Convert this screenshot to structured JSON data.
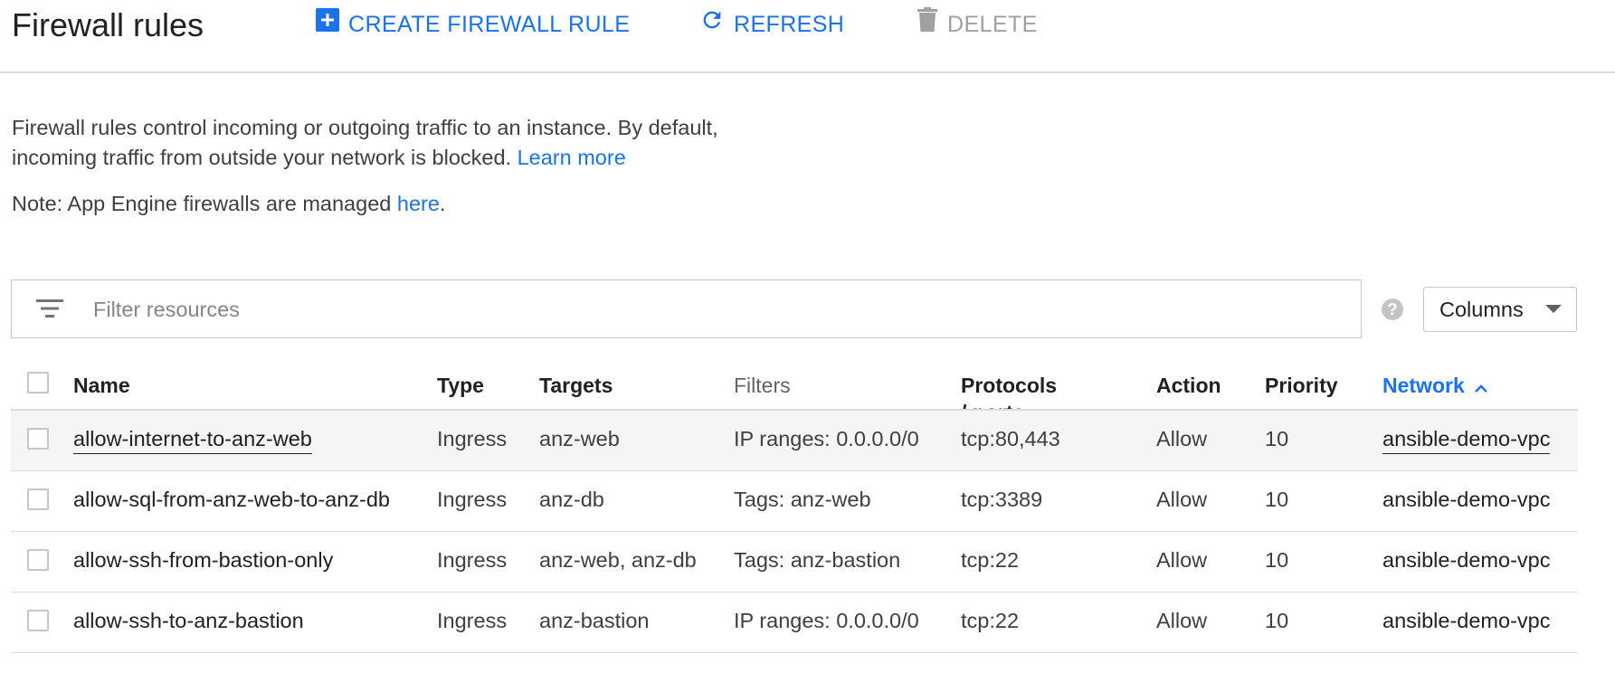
{
  "header": {
    "title": "Firewall rules",
    "create_label": "CREATE FIREWALL RULE",
    "refresh_label": "REFRESH",
    "delete_label": "DELETE"
  },
  "description": {
    "line1": "Firewall rules control incoming or outgoing traffic to an instance. By default,",
    "line2_prefix": "incoming traffic from outside your network is blocked.",
    "learn_more": "Learn more",
    "note_prefix": "Note: App Engine firewalls are managed",
    "note_link": "here",
    "note_suffix": "."
  },
  "filter": {
    "placeholder": "Filter resources",
    "help_glyph": "?",
    "columns_label": "Columns"
  },
  "table": {
    "headers": {
      "name": "Name",
      "type": "Type",
      "targets": "Targets",
      "filters": "Filters",
      "protocols": "Protocols / ports",
      "action": "Action",
      "priority": "Priority",
      "network": "Network"
    },
    "sort_column": "network",
    "sort_direction": "ascending",
    "rows": [
      {
        "name": "allow-internet-to-anz-web",
        "type": "Ingress",
        "targets": "anz-web",
        "filters": "IP ranges: 0.0.0.0/0",
        "protocols": "tcp:80,443",
        "action": "Allow",
        "priority": "10",
        "network": "ansible-demo-vpc"
      },
      {
        "name": "allow-sql-from-anz-web-to-anz-db",
        "type": "Ingress",
        "targets": "anz-db",
        "filters": "Tags: anz-web",
        "protocols": "tcp:3389",
        "action": "Allow",
        "priority": "10",
        "network": "ansible-demo-vpc"
      },
      {
        "name": "allow-ssh-from-bastion-only",
        "type": "Ingress",
        "targets": "anz-web, anz-db",
        "filters": "Tags: anz-bastion",
        "protocols": "tcp:22",
        "action": "Allow",
        "priority": "10",
        "network": "ansible-demo-vpc"
      },
      {
        "name": "allow-ssh-to-anz-bastion",
        "type": "Ingress",
        "targets": "anz-bastion",
        "filters": "IP ranges: 0.0.0.0/0",
        "protocols": "tcp:22",
        "action": "Allow",
        "priority": "10",
        "network": "ansible-demo-vpc"
      }
    ]
  },
  "colors": {
    "accent": "#1a73e8",
    "disabled": "#a0a0a0",
    "divider": "#dadce0",
    "row_hover": "#f5f5f5"
  }
}
